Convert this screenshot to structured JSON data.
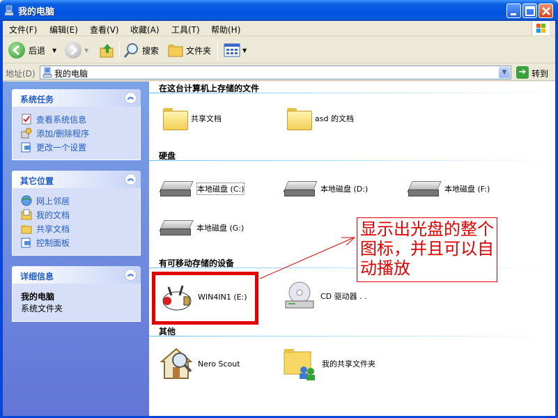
{
  "window": {
    "title": "我的电脑"
  },
  "menu": [
    "文件(F)",
    "编辑(E)",
    "查看(V)",
    "收藏(A)",
    "工具(T)",
    "帮助(H)"
  ],
  "toolbar": {
    "back": "后退",
    "search": "搜索",
    "folders": "文件夹"
  },
  "address": {
    "label": "地址(D)",
    "value": "我的电脑",
    "go": "转到"
  },
  "left": {
    "system_tasks": {
      "title": "系统任务",
      "items": [
        "查看系统信息",
        "添加/删除程序",
        "更改一个设置"
      ]
    },
    "other_places": {
      "title": "其它位置",
      "items": [
        "网上邻居",
        "我的文档",
        "共享文档",
        "控制面板"
      ]
    },
    "details": {
      "title": "详细信息",
      "name": "我的电脑",
      "desc": "系统文件夹"
    }
  },
  "main": {
    "sec_files": "在这台计算机上存储的文件",
    "files": [
      "共享文档",
      "asd 的文档"
    ],
    "sec_hdd": "硬盘",
    "disks": [
      "本地磁盘 (C:)",
      "本地磁盘 (D:)",
      "本地磁盘 (F:)",
      "本地磁盘 (G:)"
    ],
    "sec_removable": "有可移动存储的设备",
    "removable": [
      "WIN4IN1 (E:)",
      "CD 驱动器 . ."
    ],
    "sec_other": "其他",
    "other": [
      "Nero Scout",
      "我的共享文件夹"
    ]
  },
  "annotation": {
    "text": "显示出光盘的整个图标，并且可以自动播放"
  }
}
